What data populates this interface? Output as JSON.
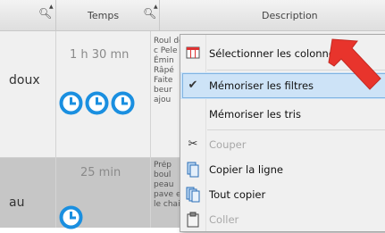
{
  "table": {
    "headers": [
      {
        "label": "",
        "icon": "search-icon"
      },
      {
        "label": "Temps",
        "icon": "search-icon"
      },
      {
        "label": "Description",
        "icon": ""
      }
    ],
    "rows": [
      {
        "name": "doux",
        "time": "1 h 30 mn",
        "clocks": 3,
        "description": "Roul de c Pele Émin Râpé Faite beur ajou"
      },
      {
        "name": "au",
        "time": "25 min",
        "clocks": 1,
        "description": "Prép boul peau pave en le chair"
      }
    ]
  },
  "context_menu": {
    "items": [
      {
        "label": "Sélectionner les colonnes",
        "icon": "table-columns-icon",
        "enabled": true,
        "checked": false
      },
      {
        "label": "Mémoriser les filtres",
        "icon": "checkmark-icon",
        "enabled": true,
        "checked": true
      },
      {
        "label": "Mémoriser les tris",
        "icon": "",
        "enabled": true,
        "checked": false
      },
      {
        "label": "Couper",
        "icon": "scissors-icon",
        "enabled": false,
        "checked": false
      },
      {
        "label": "Copier la ligne",
        "icon": "copy-icon",
        "enabled": true,
        "checked": false
      },
      {
        "label": "Tout copier",
        "icon": "copy-all-icon",
        "enabled": true,
        "checked": false
      },
      {
        "label": "Coller",
        "icon": "paste-icon",
        "enabled": false,
        "checked": false
      }
    ]
  },
  "colors": {
    "clock": "#1a8fe0",
    "highlight": "#cde3f7",
    "arrow": "#e8342c"
  }
}
